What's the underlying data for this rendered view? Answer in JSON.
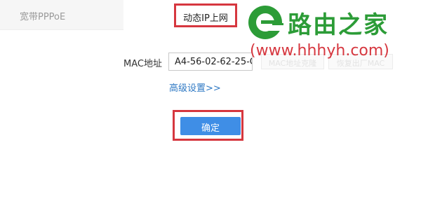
{
  "tabs": {
    "pppoe_label": "宽带PPPoE",
    "dynamic_ip_label": "动态IP上网"
  },
  "mac": {
    "label": "MAC地址",
    "value": "A4-56-02-62-25-C"
  },
  "ghost_buttons": {
    "left_label": "MAC地址克隆",
    "right_label": "恢复出厂MAC"
  },
  "advanced_link": "高级设置>>",
  "confirm_button": "确定",
  "watermark": {
    "name": "路由之家",
    "url": "(www.hhhyh.com)",
    "brand_color": "#2c9c37",
    "url_color": "#d6373f",
    "logo_icon": "green-e-logo"
  },
  "colors": {
    "highlight_border": "#d6373f",
    "primary_button": "#3f8ee6",
    "link": "#2f79c4"
  }
}
